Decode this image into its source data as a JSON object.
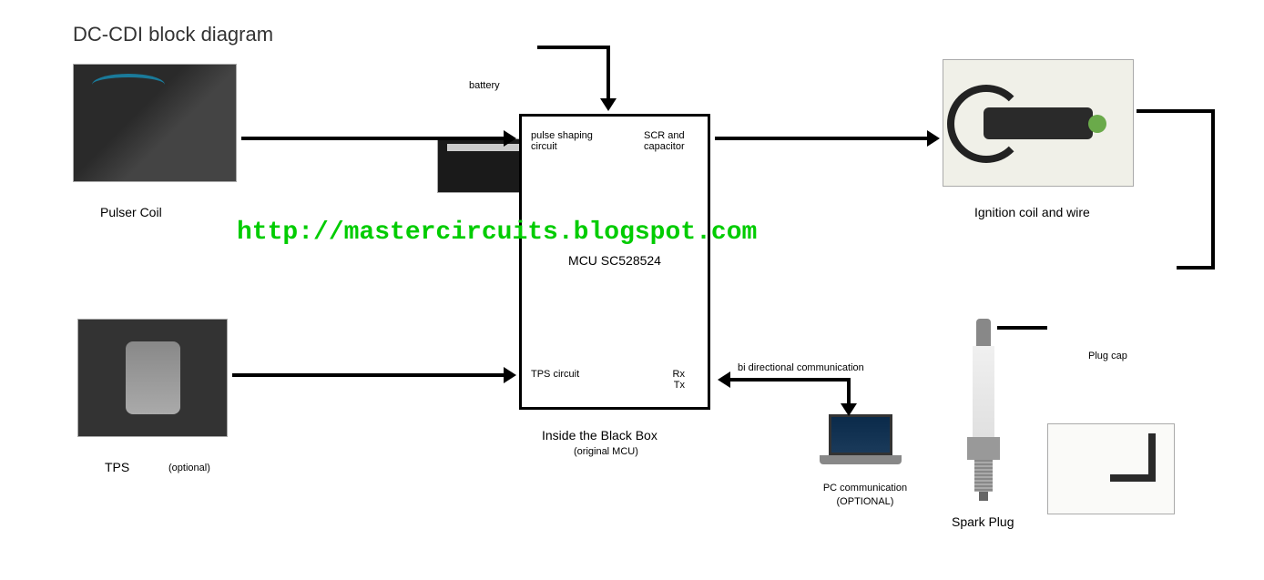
{
  "title": "DC-CDI block diagram",
  "watermark": "http://mastercircuits.blogspot.com",
  "components": {
    "pulser_coil": {
      "label": "Pulser Coil"
    },
    "battery": {
      "label": "battery"
    },
    "tps": {
      "label": "TPS",
      "note": "(optional)"
    },
    "ignition_coil": {
      "label": "Ignition coil and wire"
    },
    "plug_cap": {
      "label": "Plug cap"
    },
    "spark_plug": {
      "label": "Spark Plug"
    },
    "pc": {
      "label": "PC communication",
      "note": "(OPTIONAL)"
    }
  },
  "black_box": {
    "title": "Inside the Black Box",
    "subtitle": "(original MCU)",
    "mcu": "MCU SC528524",
    "pulse_shaping": "pulse shaping circuit",
    "scr": "SCR and capacitor",
    "tps_circuit": "TPS circuit",
    "rx": "Rx",
    "tx": "Tx"
  },
  "connections": {
    "bidir": "bi directional communication"
  }
}
